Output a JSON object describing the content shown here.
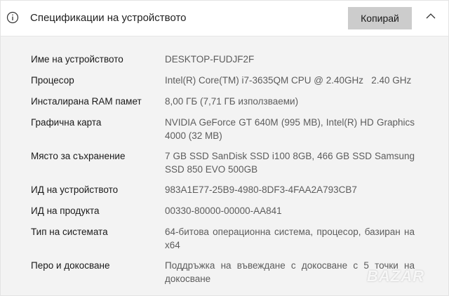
{
  "header": {
    "title": "Спецификации на устройството",
    "copy_label": "Копирай",
    "info_icon": "info-icon",
    "collapse_icon": "chevron-up-icon"
  },
  "specs": [
    {
      "label": "Име на устройството",
      "value": "DESKTOP-FUDJF2F"
    },
    {
      "label": "Процесор",
      "value": "Intel(R) Core(TM) i7-3635QM CPU @ 2.40GHz   2.40 GHz"
    },
    {
      "label": "Инсталирана RAM памет",
      "value": "8,00 ГБ (7,71 ГБ използваеми)"
    },
    {
      "label": "Графична карта",
      "value": "NVIDIA GeForce GT 640M (995 MB), Intel(R) HD Graphics 4000 (32 MB)"
    },
    {
      "label": "Място за съхранение",
      "value": "7 GB SSD SanDisk SSD i100 8GB, 466 GB SSD Samsung SSD 850 EVO 500GB"
    },
    {
      "label": "ИД на устройството",
      "value": "983A1E77-25B9-4980-8DF3-4FAA2A793CB7"
    },
    {
      "label": "ИД на продукта",
      "value": "00330-80000-00000-AA841"
    },
    {
      "label": "Тип на системата",
      "value": "64-битова операционна система, процесор, базиран на x64"
    },
    {
      "label": "Перо и докосване",
      "value": "Поддръжка на въвеждане с докосване с 5 точки на докосване"
    }
  ],
  "watermark": "BAZAR"
}
